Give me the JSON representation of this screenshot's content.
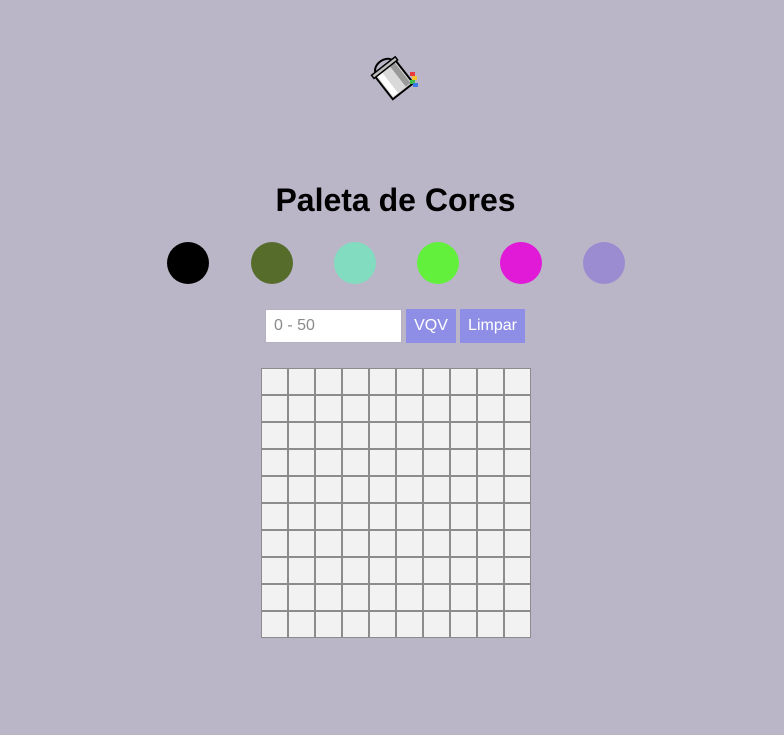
{
  "header": {
    "title": "Paleta de Cores",
    "logo_icon": "paint-bucket-icon"
  },
  "palette": {
    "colors": [
      "#000000",
      "#566c2b",
      "#82dcbf",
      "#62f03c",
      "#e01ad6",
      "#9b8bd0"
    ]
  },
  "controls": {
    "size_placeholder": "0 - 50",
    "size_value": "",
    "vqv_label": "VQV",
    "clear_label": "Limpar",
    "button_color": "#8f8ee6"
  },
  "board": {
    "rows": 10,
    "cols": 10,
    "pixel_color": "#f2f2f2"
  },
  "page": {
    "background": "#bab6c8"
  }
}
